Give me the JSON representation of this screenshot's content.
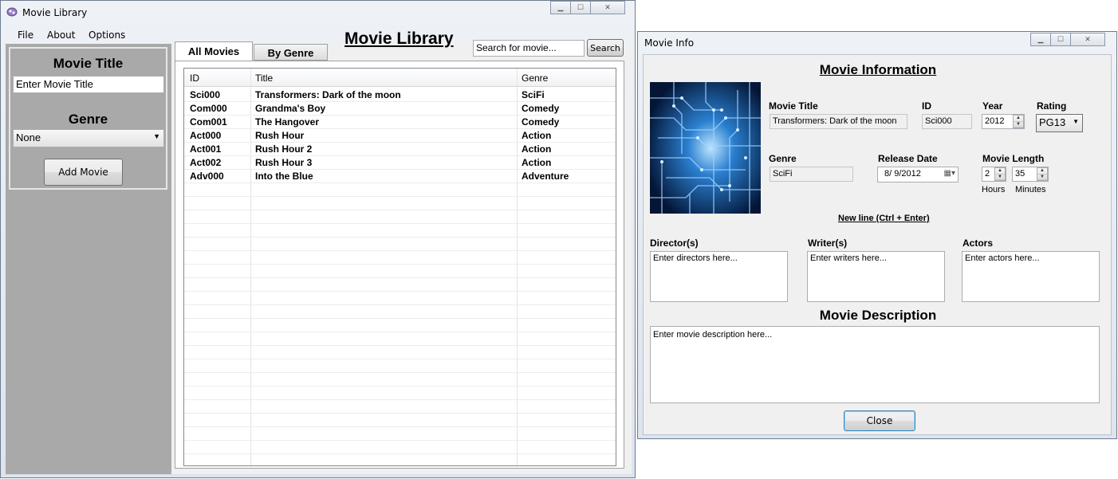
{
  "main_window": {
    "title": "Movie Library",
    "menu": [
      "File",
      "About",
      "Options"
    ],
    "side_panel": {
      "movie_title_heading": "Movie Title",
      "movie_title_input": "Enter Movie Title",
      "genre_heading": "Genre",
      "genre_select": "None",
      "add_button": "Add Movie"
    },
    "tabs": [
      "All Movies",
      "By Genre"
    ],
    "heading": "Movie Library",
    "search_input": "Search for movie...",
    "search_button": "Search",
    "grid": {
      "columns": [
        "ID",
        "Title",
        "Genre"
      ],
      "rows": [
        [
          "Sci000",
          "Transformers: Dark of the moon",
          "SciFi"
        ],
        [
          "Com000",
          "Grandma's Boy",
          "Comedy"
        ],
        [
          "Com001",
          "The Hangover",
          "Comedy"
        ],
        [
          "Act000",
          "Rush Hour",
          "Action"
        ],
        [
          "Act001",
          "Rush Hour 2",
          "Action"
        ],
        [
          "Act002",
          "Rush Hour 3",
          "Action"
        ],
        [
          "Adv000",
          "Into the Blue",
          "Adventure"
        ]
      ]
    }
  },
  "info_window": {
    "title": "Movie Info",
    "heading": "Movie Information",
    "labels": {
      "movie_title": "Movie Title",
      "id": "ID",
      "year": "Year",
      "rating": "Rating",
      "genre": "Genre",
      "release_date": "Release Date",
      "movie_length": "Movie Length",
      "hours": "Hours",
      "minutes": "Minutes",
      "new_line_hint": "New line (Ctrl + Enter)",
      "directors": "Director(s)",
      "writers": "Writer(s)",
      "actors": "Actors",
      "description": "Movie Description"
    },
    "values": {
      "movie_title": "Transformers: Dark of the moon",
      "id": "Sci000",
      "year": "2012",
      "rating": "PG13",
      "genre": "SciFi",
      "release_date": "8/  9/2012",
      "hours": "2",
      "minutes": "35"
    },
    "placeholders": {
      "directors": "Enter directors here...",
      "writers": "Enter writers here...",
      "actors": "Enter actors here...",
      "description": "Enter movie description here..."
    },
    "close_button": "Close"
  }
}
